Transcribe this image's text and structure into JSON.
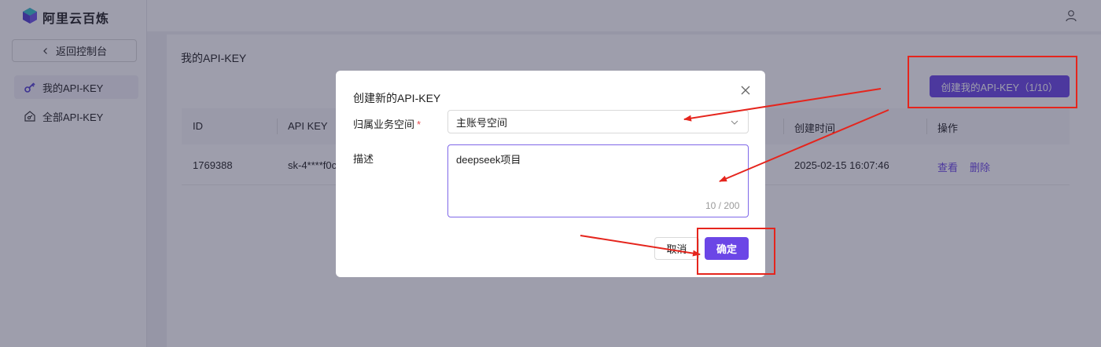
{
  "header": {
    "brand": "阿里云百炼"
  },
  "sidebar": {
    "back_label": "返回控制台",
    "items": [
      {
        "label": "我的API-KEY",
        "active": true
      },
      {
        "label": "全部API-KEY",
        "active": false
      }
    ]
  },
  "main": {
    "title": "我的API-KEY",
    "create_button": "创建我的API-KEY（1/10）",
    "table": {
      "columns": [
        "ID",
        "API KEY",
        "创建时间",
        "操作"
      ],
      "rows": [
        {
          "id": "1769388",
          "api_key": "sk-4****f0c",
          "created": "2025-02-15 16:07:46",
          "actions": [
            "查看",
            "删除"
          ]
        }
      ]
    }
  },
  "modal": {
    "title": "创建新的API-KEY",
    "workspace_label": "归属业务空间",
    "required_mark": "*",
    "workspace_value": "主账号空间",
    "description_label": "描述",
    "description_value": "deepseek项目",
    "char_counter": "10 / 200",
    "cancel_label": "取消",
    "ok_label": "确定"
  },
  "colors": {
    "accent": "#6b46e6",
    "annotation": "#e5251d",
    "overlay": "rgba(40,40,70,0.45)"
  },
  "icons": [
    "logo-icon",
    "user-icon",
    "chevron-left-icon",
    "key-icon",
    "home-key-icon",
    "close-icon",
    "chevron-down-icon"
  ]
}
